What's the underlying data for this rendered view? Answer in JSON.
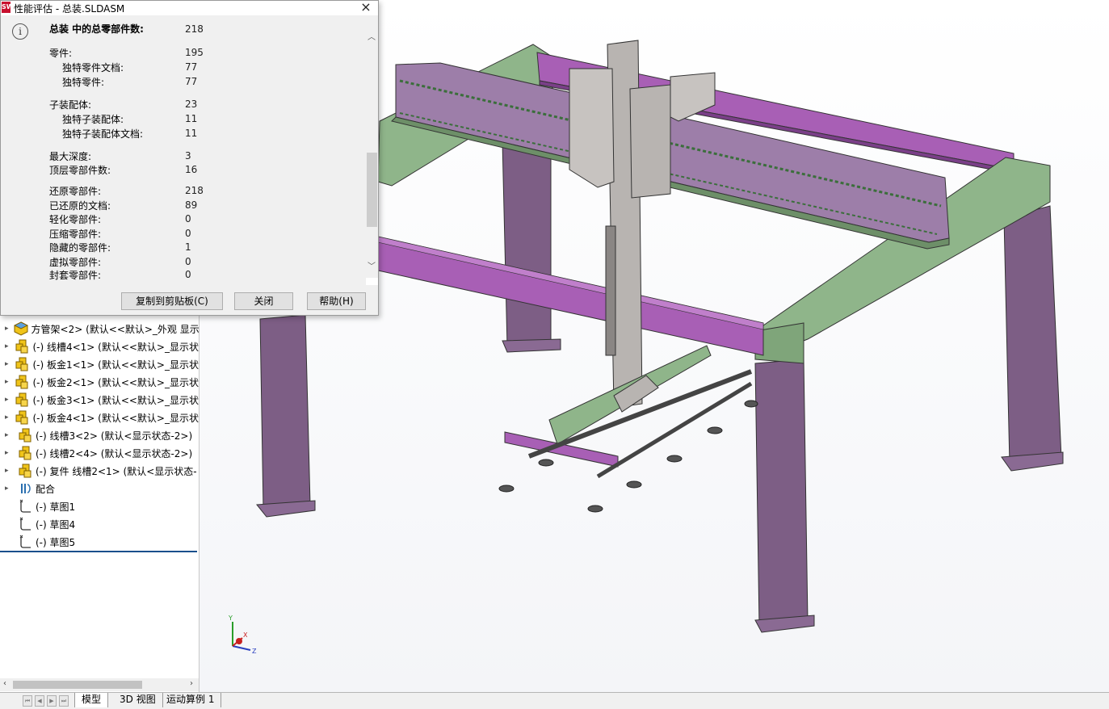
{
  "dialog": {
    "title": "性能评估 - 总装.SLDASM",
    "app_icon_text": "SW",
    "close_symbol": "×",
    "header_label": "总装  中的总零部件数:",
    "header_value": "218",
    "stats": [
      {
        "label": "零件:",
        "value": "195",
        "indent": false
      },
      {
        "label": "独特零件文档:",
        "value": "77",
        "indent": true
      },
      {
        "label": "独特零件:",
        "value": "77",
        "indent": true
      },
      {
        "label": "子装配体:",
        "value": "23",
        "indent": false
      },
      {
        "label": "独特子装配体:",
        "value": "11",
        "indent": true
      },
      {
        "label": "独特子装配体文档:",
        "value": "11",
        "indent": true
      },
      {
        "label": "最大深度:",
        "value": "3",
        "indent": false
      },
      {
        "label": "顶层零部件数:",
        "value": "16",
        "indent": false
      },
      {
        "label": "还原零部件:",
        "value": "218",
        "indent": false
      },
      {
        "label": "已还原的文档:",
        "value": "89",
        "indent": false
      },
      {
        "label": "轻化零部件:",
        "value": "0",
        "indent": false
      },
      {
        "label": "压缩零部件:",
        "value": "0",
        "indent": false
      },
      {
        "label": "隐藏的零部件:",
        "value": "1",
        "indent": false
      },
      {
        "label": "虚拟零部件:",
        "value": "0",
        "indent": false
      },
      {
        "label": "封套零部件:",
        "value": "0",
        "indent": false
      }
    ],
    "buttons": {
      "copy": "复制到剪贴板(C)",
      "close": "关闭",
      "help": "帮助(H)"
    }
  },
  "tree": {
    "items": [
      {
        "label": "方管架<2> (默认<<默认>_外观 显示",
        "icon": "part-icon",
        "expander": "▸"
      },
      {
        "label": "(-) 线槽4<1> (默认<<默认>_显示状",
        "icon": "assembly-icon",
        "expander": "▸"
      },
      {
        "label": "(-) 板金1<1> (默认<<默认>_显示状",
        "icon": "assembly-icon",
        "expander": "▸"
      },
      {
        "label": "(-) 板金2<1> (默认<<默认>_显示状",
        "icon": "assembly-icon",
        "expander": "▸"
      },
      {
        "label": "(-) 板金3<1> (默认<<默认>_显示状",
        "icon": "assembly-icon",
        "expander": "▸"
      },
      {
        "label": "(-) 板金4<1> (默认<<默认>_显示状",
        "icon": "assembly-icon",
        "expander": "▸"
      },
      {
        "label": "(-) 线槽3<2> (默认<显示状态-2>)",
        "icon": "assembly-icon",
        "expander": "▸"
      },
      {
        "label": "(-) 线槽2<4> (默认<显示状态-2>)",
        "icon": "assembly-icon",
        "expander": "▸"
      },
      {
        "label": "(-) 复件 线槽2<1> (默认<显示状态-",
        "icon": "assembly-icon",
        "expander": "▸"
      },
      {
        "label": "配合",
        "icon": "mates-icon",
        "expander": "▸"
      },
      {
        "label": "(-) 草图1",
        "icon": "sketch-icon",
        "expander": ""
      },
      {
        "label": "(-) 草图4",
        "icon": "sketch-icon",
        "expander": ""
      },
      {
        "label": "(-) 草图5",
        "icon": "sketch-icon",
        "expander": ""
      }
    ],
    "scroll_left": "‹",
    "scroll_right": "›"
  },
  "tabs": {
    "items": [
      "模型",
      "3D 视图",
      "运动算例 1"
    ],
    "active": "模型"
  },
  "triad": {
    "x": "X",
    "y": "Y",
    "z": "Z"
  },
  "colors": {
    "purple_beam": "#a85fb5",
    "green_beam": "#8fb58a",
    "column": "#7d5e85",
    "grey_part": "#b8b4b1",
    "dialog_bg": "#f0f0f0",
    "tree_divider": "#1a4f8c"
  }
}
